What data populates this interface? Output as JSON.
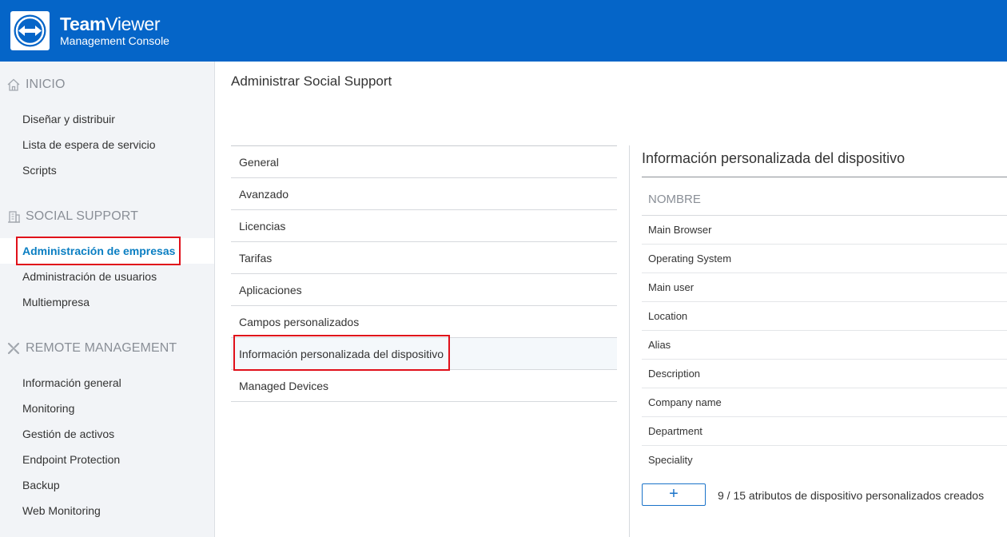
{
  "header": {
    "brand_bold": "Team",
    "brand_regular": "Viewer",
    "subtitle": "Management Console",
    "logo_icon": "teamviewer-arrows-icon",
    "color": "#0565c8"
  },
  "sidebar": {
    "sections": [
      {
        "title": "INICIO",
        "icon": "home-icon",
        "items": [
          "Diseñar y distribuir",
          "Lista de espera de servicio",
          "Scripts"
        ]
      },
      {
        "title": "SOCIAL SUPPORT",
        "icon": "building-icon",
        "items": [
          "Administración de empresas",
          "Administración de usuarios",
          "Multiempresa"
        ]
      },
      {
        "title": "REMOTE MANAGEMENT",
        "icon": "remote-cross-icon",
        "items": [
          "Información general",
          "Monitoring",
          "Gestión de activos",
          "Endpoint Protection",
          "Backup",
          "Web Monitoring"
        ]
      }
    ],
    "active_item": "Administración de empresas",
    "active_color": "#0a7ec2",
    "highlight_color": "#e0101a"
  },
  "main": {
    "page_title": "Administrar Social Support",
    "menu": [
      "General",
      "Avanzado",
      "Licencias",
      "Tarifas",
      "Aplicaciones",
      "Campos personalizados",
      "Información personalizada del dispositivo",
      "Managed Devices"
    ],
    "selected_menu": "Información personalizada del dispositivo"
  },
  "panel": {
    "title": "Información personalizada del dispositivo",
    "column_header": "NOMBRE",
    "attributes": [
      "Main Browser",
      "Operating System",
      "Main user",
      "Location",
      "Alias",
      "Description",
      "Company name",
      "Department",
      "Speciality"
    ],
    "add_label": "+",
    "count_text": "9 / 15 atributos de dispositivo personalizados creados"
  }
}
